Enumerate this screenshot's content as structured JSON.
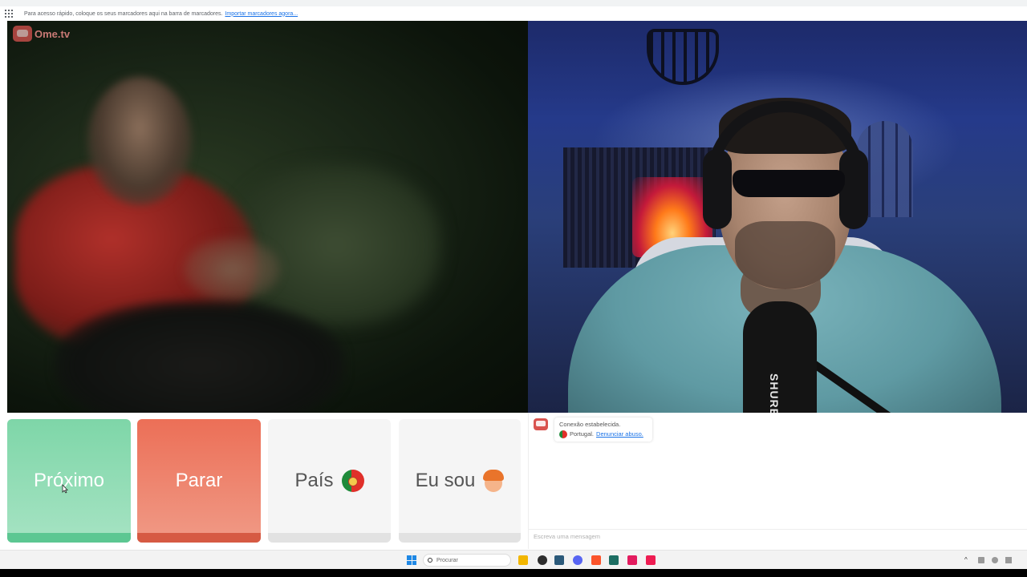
{
  "browser": {
    "bookmarks_bar_text": "Para acesso rápido, coloque os seus marcadores aqui na barra de marcadores.",
    "import_bookmarks_link": "Importar marcadores agora..."
  },
  "logo": {
    "text": "Ome.tv"
  },
  "buttons": {
    "next": "Próximo",
    "stop": "Parar",
    "country": "País",
    "i_am": "Eu sou"
  },
  "chat": {
    "status": "Conexão estabelecida.",
    "country": "Portugal.",
    "report_abuse": "Denunciar abuso.",
    "input_placeholder": "Escreva uma mensagem"
  },
  "remote_video": {
    "mic_brand": "SHURE"
  },
  "taskbar": {
    "search_placeholder": "Procurar"
  },
  "colors": {
    "next_button": "#7ed6a8",
    "stop_button": "#ec6f57",
    "neutral_button": "#f5f5f5",
    "link": "#1a73e8"
  },
  "icons": {
    "country_flag": "portugal-flag-icon",
    "gender_emoji": "boy-face-icon"
  }
}
